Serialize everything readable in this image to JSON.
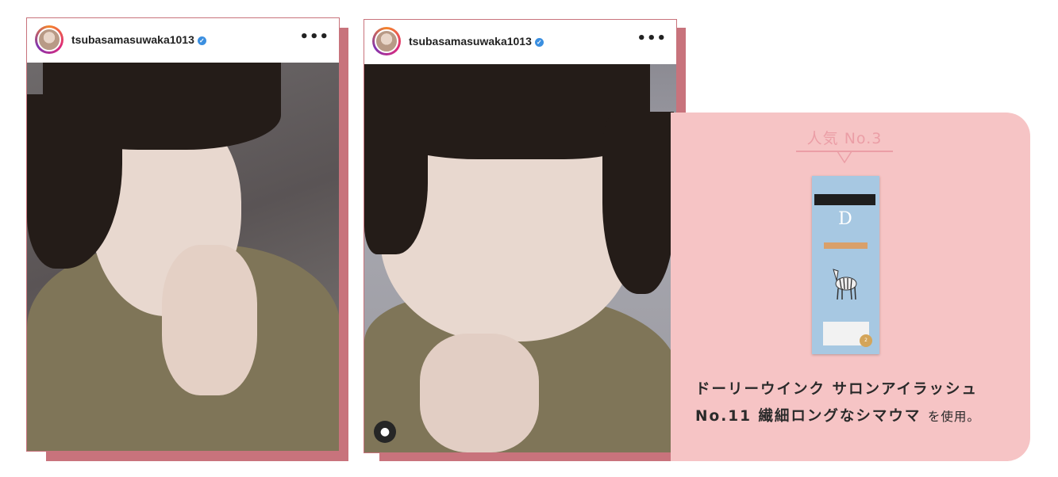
{
  "posts": [
    {
      "username": "tsubasamasuwaka1013",
      "verified_icon": "verified-check-icon",
      "more_icon": "more-options-icon",
      "more_label": "•••"
    },
    {
      "username": "tsubasamasuwaka1013",
      "verified_icon": "verified-check-icon",
      "more_icon": "more-options-icon",
      "more_label": "•••",
      "tag_icon": "person-tag-icon"
    }
  ],
  "feature": {
    "rank_label": "人気 No.3",
    "product_name_line1": "ドーリーウインク サロンアイラッシュ",
    "product_name_line2_bold": "No.11 繊細ロングなシマウマ",
    "product_name_line2_suffix": "を使用。"
  },
  "colors": {
    "accent_shadow": "#c8737c",
    "panel_bg": "#f6c4c5",
    "rank_text": "#eb9ea6"
  }
}
